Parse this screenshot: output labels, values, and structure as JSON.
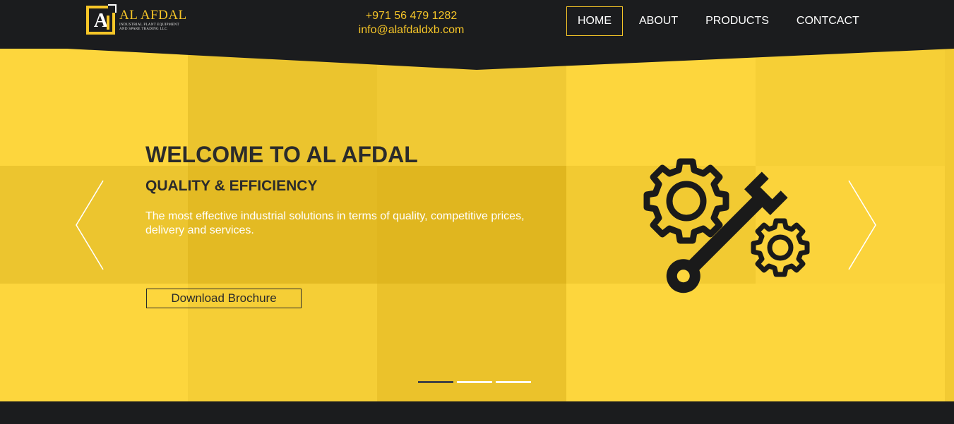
{
  "header": {
    "logo": {
      "title": "AL AFDAL",
      "subtitle_line1": "INDUSTRIAL PLANT EQUIPMENT",
      "subtitle_line2": "AND SPARE TRADING LLC",
      "mark_letter": "A",
      "icon": "logo-icon"
    },
    "contact": {
      "phone": "+971 56 479 1282",
      "email": "info@alafdaldxb.com"
    },
    "nav": {
      "items": [
        {
          "label": "HOME",
          "active": true
        },
        {
          "label": "ABOUT",
          "active": false
        },
        {
          "label": "PRODUCTS",
          "active": false
        },
        {
          "label": "CONTCACT",
          "active": false
        }
      ]
    }
  },
  "hero": {
    "title": "WELCOME TO AL AFDAL",
    "subtitle": "QUALITY & EFFICIENCY",
    "description": "The most effective industrial solutions in terms of quality, competitive prices, delivery and services.",
    "button_label": "Download Brochure",
    "illustration_icon": "gear-wrench-icon",
    "prev_icon": "chevron-left-icon",
    "next_icon": "chevron-right-icon",
    "slides_total": 3,
    "slide_active": 1
  },
  "colors": {
    "accent": "#f7c628",
    "dark": "#1b1c1e",
    "hero_bg": "#fdd63d",
    "text_dark": "#2b2b2b",
    "text_light": "#ffffff"
  }
}
